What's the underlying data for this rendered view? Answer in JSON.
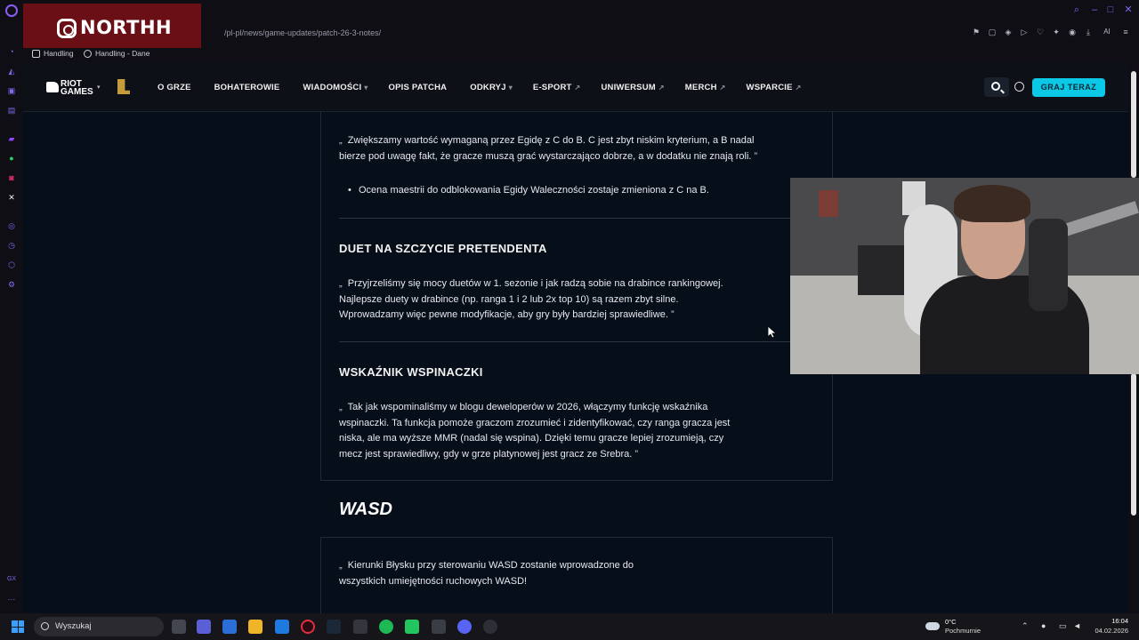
{
  "browser": {
    "url": "/pl-pl/news/game-updates/patch-26-3-notes/",
    "bookmarks": [
      {
        "label": "Handling"
      },
      {
        "label": "Handling - Dane"
      }
    ],
    "ext_ai_label": "AI"
  },
  "overlay": {
    "brand": "NORTHH"
  },
  "site": {
    "logo_line1": "RIOT",
    "logo_line2": "GAMES",
    "nav": [
      {
        "label": "O GRZE",
        "arrow": ""
      },
      {
        "label": "BOHATEROWIE",
        "arrow": ""
      },
      {
        "label": "WIADOMOŚCI",
        "arrow": "▾"
      },
      {
        "label": "OPIS PATCHA",
        "arrow": ""
      },
      {
        "label": "ODKRYJ",
        "arrow": "▾"
      },
      {
        "label": "E-SPORT",
        "arrow": "↗"
      },
      {
        "label": "UNIWERSUM",
        "arrow": "↗"
      },
      {
        "label": "MERCH",
        "arrow": "↗"
      },
      {
        "label": "WSPARCIE",
        "arrow": "↗"
      }
    ],
    "play_button": "GRAJ TERAZ"
  },
  "article": {
    "quote1": "Zwiększamy wartość wymaganą przez Egidę z C do B. C jest zbyt niskim kryterium, a B nadal bierze pod uwagę fakt, że gracze muszą grać wystarczająco dobrze, a w dodatku nie znają roli.",
    "bullet1": "Ocena maestrii do odblokowania Egidy Waleczności zostaje zmieniona z C na B.",
    "section2_title": "DUET NA SZCZYCIE PRETENDENTA",
    "quote2": "Przyjrzeliśmy się mocy duetów w 1. sezonie i jak radzą sobie na drabince rankingowej. Najlepsze duety w drabince (np. ranga 1 i 2 lub 2x top 10) są razem zbyt silne. Wprowadzamy więc pewne modyfikacje, aby gry były bardziej sprawiedliwe.",
    "section3_title": "WSKAŹNIK WSPINACZKI",
    "quote3": "Tak jak wspominaliśmy w blogu deweloperów w 2026, włączymy funkcję wskaźnika wspinaczki. Ta funkcja pomoże graczom zrozumieć i zidentyfikować, czy ranga gracza jest niska, ale ma wyższe MMR (nadal się wspina). Dzięki temu gracze lepiej zrozumieją, czy mecz jest sprawiedliwy, gdy w grze platynowej jest gracz ze Srebra.",
    "heading_wasd": "WASD",
    "quote4": "Kierunki Błysku przy sterowaniu WASD zostanie wprowadzone do wszystkich umiejętności ruchowych WASD!",
    "open_quote": "„",
    "close_quote": "”"
  },
  "taskbar": {
    "search_label": "Wyszukaj",
    "weather_temp": "0°C",
    "weather_desc": "Pochmurnie",
    "time": "16:04",
    "date": "04.02.2026"
  },
  "colors": {
    "accent": "#0ac8e6",
    "page_bg": "#060e1a",
    "brand_red": "#6b0f17"
  }
}
